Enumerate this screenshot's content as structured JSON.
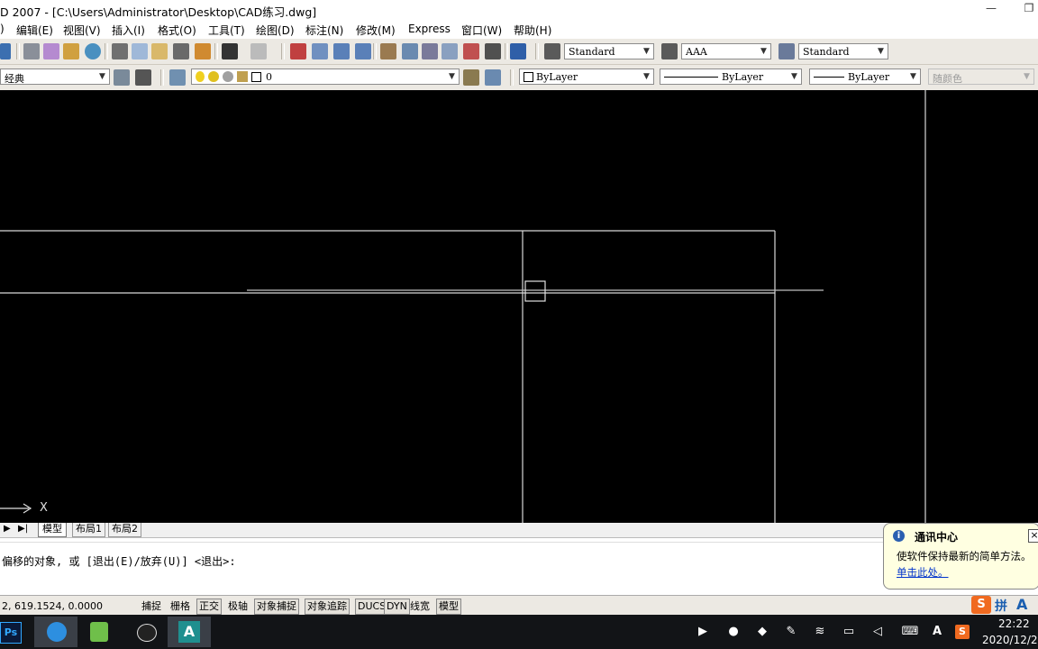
{
  "window": {
    "title": "D 2007 - [C:\\Users\\Administrator\\Desktop\\CAD练习.dwg]",
    "minimize_symbol": "—",
    "restore_symbol": "❐"
  },
  "menu": {
    "partial": ")",
    "items": [
      "编辑(E)",
      "视图(V)",
      "插入(I)",
      "格式(O)",
      "工具(T)",
      "绘图(D)",
      "标注(N)",
      "修改(M)",
      "Express",
      "窗口(W)",
      "帮助(H)"
    ]
  },
  "toolbar_styles": {
    "text_style": "Standard",
    "dim_style": "AAA",
    "table_style": "Standard"
  },
  "toolbar_layers": {
    "workspace": "经典",
    "layer": "0",
    "color": "ByLayer",
    "linetype": "ByLayer",
    "lineweight": "ByLayer",
    "plotstyle": "随颜色"
  },
  "ucs": {
    "x_label": "X"
  },
  "layout_tabs": {
    "nav": [
      "▶",
      "▶|"
    ],
    "tabs": [
      "模型",
      "布局1",
      "布局2"
    ]
  },
  "command": {
    "history": "偏移的对象, 或 [退出(E)/放弃(U)] <退出>:",
    "current": ""
  },
  "status": {
    "coords": "2, 619.1524, 0.0000",
    "toggles": [
      {
        "label": "捕捉",
        "on": false
      },
      {
        "label": "栅格",
        "on": false
      },
      {
        "label": "正交",
        "on": true
      },
      {
        "label": "极轴",
        "on": false
      },
      {
        "label": "对象捕捉",
        "on": true
      },
      {
        "label": "对象追踪",
        "on": true
      },
      {
        "label": "DUCS",
        "on": true
      },
      {
        "label": "DYN",
        "on": true
      },
      {
        "label": "线宽",
        "on": false
      },
      {
        "label": "模型",
        "on": true
      }
    ]
  },
  "notification": {
    "title": "通讯中心",
    "message": "使软件保持最新的简单方法。",
    "link": "单击此处。",
    "close": "×"
  },
  "ime": {
    "mode": "拼",
    "letter": "A"
  },
  "taskbar": {
    "apps": [
      "photoshop-icon",
      "browser-icon",
      "notes-icon",
      "qq-icon",
      "autocad-icon"
    ],
    "ps_label": "Ps",
    "tray_letter": "A",
    "time": "22:22",
    "date": "2020/12/2"
  },
  "colors": {
    "canvas_bg": "#000000",
    "drawing_line": "#d8d8d8",
    "taskbar_bg": "#121417",
    "notification_bg": "#ffffe1",
    "link": "#0033cc"
  }
}
